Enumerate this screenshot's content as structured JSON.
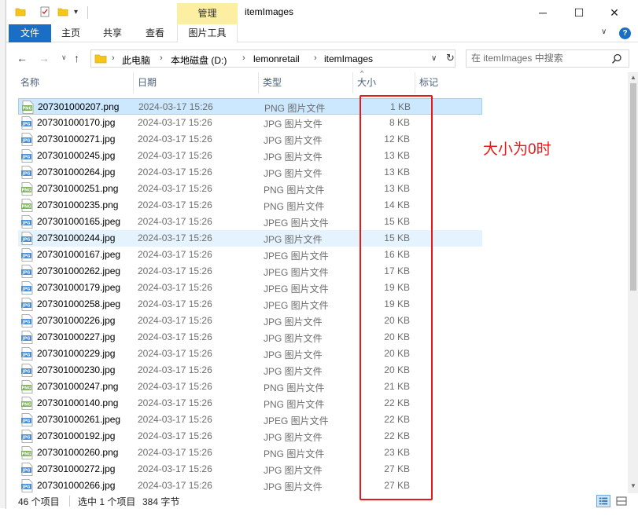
{
  "window": {
    "title": "itemImages",
    "manage_tab": "管理",
    "min": "─",
    "max": "☐",
    "close": "✕",
    "qa_dropdown": "▾"
  },
  "ribbon": {
    "tabs": {
      "file": "文件",
      "home": "主页",
      "share": "共享",
      "view": "查看",
      "picture_tools": "图片工具"
    },
    "chevron": "∨",
    "help": "?"
  },
  "nav": {
    "back": "←",
    "forward": "→",
    "recent": "∨",
    "up": "↑",
    "breadcrumb": [
      "此电脑",
      "本地磁盘 (D:)",
      "lemonretail",
      "itemImages"
    ],
    "breadcrumb_sep": "›",
    "dropdown": "∨",
    "refresh": "↻",
    "search_placeholder": "在 itemImages 中搜索"
  },
  "columns": {
    "name": "名称",
    "date": "日期",
    "type": "类型",
    "size": "大小",
    "tags": "标记",
    "sort_arrow": "^"
  },
  "files": [
    {
      "name": "207301000207.png",
      "date": "2024-03-17 15:26",
      "type": "PNG 图片文件",
      "size": "1 KB",
      "kind": "png",
      "state": "selected"
    },
    {
      "name": "207301000170.jpg",
      "date": "2024-03-17 15:26",
      "type": "JPG 图片文件",
      "size": "8 KB",
      "kind": "jpg",
      "state": ""
    },
    {
      "name": "207301000271.jpg",
      "date": "2024-03-17 15:26",
      "type": "JPG 图片文件",
      "size": "12 KB",
      "kind": "jpg",
      "state": ""
    },
    {
      "name": "207301000245.jpg",
      "date": "2024-03-17 15:26",
      "type": "JPG 图片文件",
      "size": "13 KB",
      "kind": "jpg",
      "state": ""
    },
    {
      "name": "207301000264.jpg",
      "date": "2024-03-17 15:26",
      "type": "JPG 图片文件",
      "size": "13 KB",
      "kind": "jpg",
      "state": ""
    },
    {
      "name": "207301000251.png",
      "date": "2024-03-17 15:26",
      "type": "PNG 图片文件",
      "size": "13 KB",
      "kind": "png",
      "state": ""
    },
    {
      "name": "207301000235.png",
      "date": "2024-03-17 15:26",
      "type": "PNG 图片文件",
      "size": "14 KB",
      "kind": "png",
      "state": ""
    },
    {
      "name": "207301000165.jpeg",
      "date": "2024-03-17 15:26",
      "type": "JPEG 图片文件",
      "size": "15 KB",
      "kind": "jpg",
      "state": ""
    },
    {
      "name": "207301000244.jpg",
      "date": "2024-03-17 15:26",
      "type": "JPG 图片文件",
      "size": "15 KB",
      "kind": "jpg",
      "state": "hover"
    },
    {
      "name": "207301000167.jpeg",
      "date": "2024-03-17 15:26",
      "type": "JPEG 图片文件",
      "size": "16 KB",
      "kind": "jpg",
      "state": ""
    },
    {
      "name": "207301000262.jpeg",
      "date": "2024-03-17 15:26",
      "type": "JPEG 图片文件",
      "size": "17 KB",
      "kind": "jpg",
      "state": ""
    },
    {
      "name": "207301000179.jpeg",
      "date": "2024-03-17 15:26",
      "type": "JPEG 图片文件",
      "size": "19 KB",
      "kind": "jpg",
      "state": ""
    },
    {
      "name": "207301000258.jpeg",
      "date": "2024-03-17 15:26",
      "type": "JPEG 图片文件",
      "size": "19 KB",
      "kind": "jpg",
      "state": ""
    },
    {
      "name": "207301000226.jpg",
      "date": "2024-03-17 15:26",
      "type": "JPG 图片文件",
      "size": "20 KB",
      "kind": "jpg",
      "state": ""
    },
    {
      "name": "207301000227.jpg",
      "date": "2024-03-17 15:26",
      "type": "JPG 图片文件",
      "size": "20 KB",
      "kind": "jpg",
      "state": ""
    },
    {
      "name": "207301000229.jpg",
      "date": "2024-03-17 15:26",
      "type": "JPG 图片文件",
      "size": "20 KB",
      "kind": "jpg",
      "state": ""
    },
    {
      "name": "207301000230.jpg",
      "date": "2024-03-17 15:26",
      "type": "JPG 图片文件",
      "size": "20 KB",
      "kind": "jpg",
      "state": ""
    },
    {
      "name": "207301000247.png",
      "date": "2024-03-17 15:26",
      "type": "PNG 图片文件",
      "size": "21 KB",
      "kind": "png",
      "state": ""
    },
    {
      "name": "207301000140.png",
      "date": "2024-03-17 15:26",
      "type": "PNG 图片文件",
      "size": "22 KB",
      "kind": "png",
      "state": ""
    },
    {
      "name": "207301000261.jpeg",
      "date": "2024-03-17 15:26",
      "type": "JPEG 图片文件",
      "size": "22 KB",
      "kind": "jpg",
      "state": ""
    },
    {
      "name": "207301000192.jpg",
      "date": "2024-03-17 15:26",
      "type": "JPG 图片文件",
      "size": "22 KB",
      "kind": "jpg",
      "state": ""
    },
    {
      "name": "207301000260.png",
      "date": "2024-03-17 15:26",
      "type": "PNG 图片文件",
      "size": "23 KB",
      "kind": "png",
      "state": ""
    },
    {
      "name": "207301000272.jpg",
      "date": "2024-03-17 15:26",
      "type": "JPG 图片文件",
      "size": "27 KB",
      "kind": "jpg",
      "state": ""
    },
    {
      "name": "207301000266.jpg",
      "date": "2024-03-17 15:26",
      "type": "JPG 图片文件",
      "size": "27 KB",
      "kind": "jpg",
      "state": ""
    }
  ],
  "annotation": {
    "text": "大小为0时",
    "color": "#e81818"
  },
  "scrollbar": {
    "up": "▲",
    "down": "▼"
  },
  "status": {
    "count": "46 个项目",
    "selected": "选中 1 个项目",
    "size": "384 字节"
  },
  "colors": {
    "accent": "#1a6fc4",
    "manage_tab": "#fcefa1",
    "selected_row": "#cce8ff",
    "hover_row": "#e5f3ff"
  },
  "icons": {
    "jpg_label": "JPG",
    "png_label": "PNG"
  }
}
